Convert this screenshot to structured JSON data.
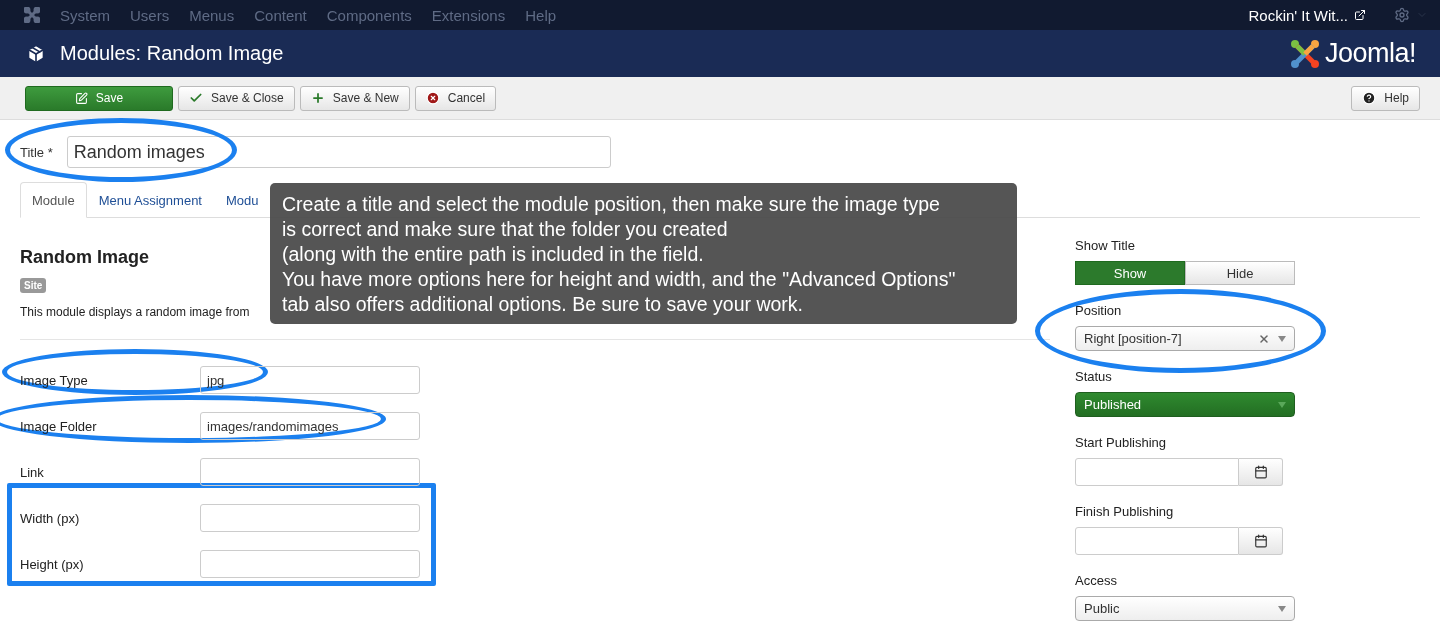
{
  "top_menu": {
    "items": [
      "System",
      "Users",
      "Menus",
      "Content",
      "Components",
      "Extensions",
      "Help"
    ],
    "site_link": "Rockin' It Wit..."
  },
  "header": {
    "title": "Modules: Random Image",
    "logo_text": "Joomla!"
  },
  "toolbar": {
    "buttons": [
      {
        "label": "Save",
        "kind": "primary"
      },
      {
        "label": "Save & Close",
        "kind": "check"
      },
      {
        "label": "Save & New",
        "kind": "plus"
      },
      {
        "label": "Cancel",
        "kind": "cancel"
      }
    ],
    "help": "Help"
  },
  "title_field": {
    "label": "Title *",
    "value": "Random images"
  },
  "tabs": [
    {
      "label": "Module",
      "selected": true
    },
    {
      "label": "Menu Assignment",
      "selected": false
    },
    {
      "label": "Modu",
      "selected": false
    }
  ],
  "module": {
    "heading": "Random Image",
    "badge": "Site",
    "description": "This module displays a random image from"
  },
  "fields": [
    {
      "label": "Image Type",
      "value": "jpg"
    },
    {
      "label": "Image Folder",
      "value": "images/randomimages"
    },
    {
      "label": "Link"
    },
    {
      "label": "Width (px)"
    },
    {
      "label": "Height (px)"
    }
  ],
  "sidebar": {
    "show_title": {
      "label": "Show Title",
      "options": [
        {
          "label": "Show",
          "selected": true
        },
        {
          "label": "Hide",
          "selected": false
        }
      ]
    },
    "position": {
      "label": "Position",
      "value": "Right [position-7]"
    },
    "status": {
      "label": "Status",
      "value": "Published"
    },
    "start_publishing": {
      "label": "Start Publishing"
    },
    "finish_publishing": {
      "label": "Finish Publishing"
    },
    "access": {
      "label": "Access",
      "value": "Public"
    }
  },
  "tooltip": {
    "lines": [
      "Create a title and select the module position, then make sure the image type",
      "is correct and make sure that the folder you created",
      "(along with the entire path is included in the field.",
      "You have more options here for height and width, and the \"Advanced Options\"",
      "tab also offers additional options. Be sure to save your work."
    ]
  }
}
